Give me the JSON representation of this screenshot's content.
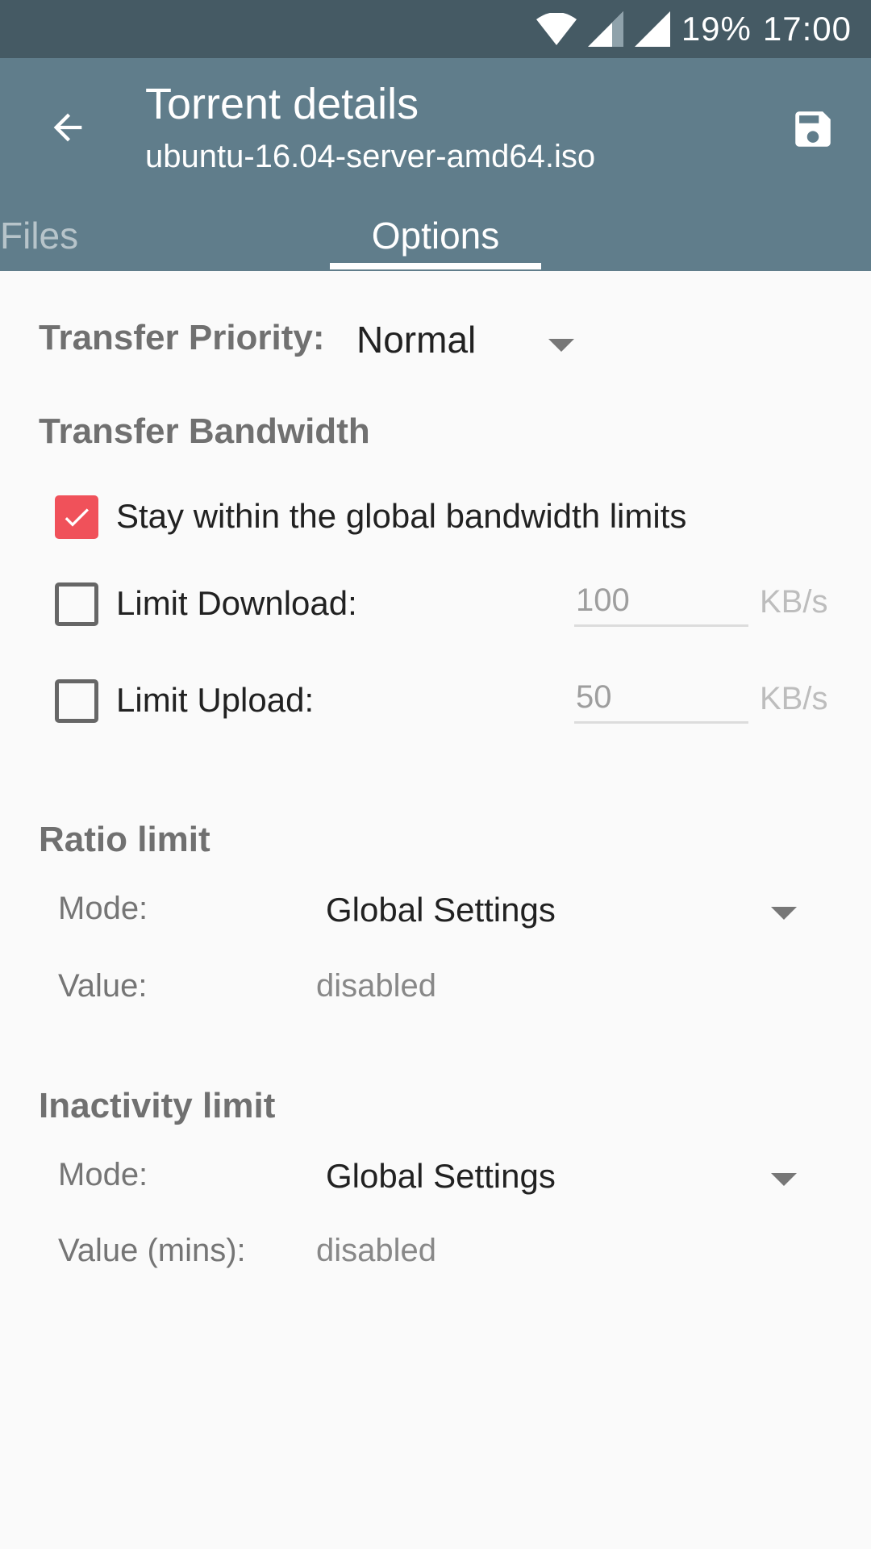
{
  "status_bar": {
    "battery": "19%",
    "time": "17:00"
  },
  "app_bar": {
    "title": "Torrent details",
    "subtitle": "ubuntu-16.04-server-amd64.iso"
  },
  "tabs": [
    {
      "label": "Files",
      "active": false
    },
    {
      "label": "Options",
      "active": true
    }
  ],
  "priority": {
    "label": "Transfer Priority:",
    "value": "Normal"
  },
  "bandwidth": {
    "heading": "Transfer Bandwidth",
    "stay_global": {
      "label": "Stay within the global bandwidth limits",
      "checked": true
    },
    "limit_download": {
      "label": "Limit Download:",
      "checked": false,
      "value": "100",
      "unit": "KB/s"
    },
    "limit_upload": {
      "label": "Limit Upload:",
      "checked": false,
      "value": "50",
      "unit": "KB/s"
    }
  },
  "ratio": {
    "heading": "Ratio limit",
    "mode_label": "Mode:",
    "mode_value": "Global Settings",
    "value_label": "Value:",
    "value": "disabled"
  },
  "inactivity": {
    "heading": "Inactivity limit",
    "mode_label": "Mode:",
    "mode_value": "Global Settings",
    "value_label": "Value (mins):",
    "value": "disabled"
  },
  "colors": {
    "status_bar": "#455a64",
    "app_bar": "#607d8b",
    "accent": "#f0515a"
  }
}
